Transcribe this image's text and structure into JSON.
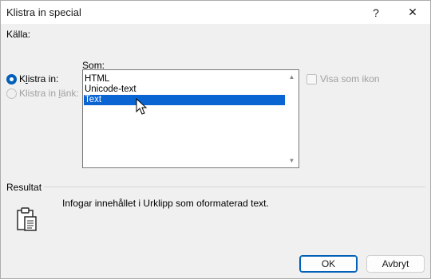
{
  "window": {
    "title": "Klistra in special",
    "help_label": "?",
    "close_label": "✕"
  },
  "source": {
    "label": "Källa:"
  },
  "paste_options": [
    {
      "prefix": "K",
      "underlined": "l",
      "rest": "istra in:",
      "checked": true,
      "enabled": true
    },
    {
      "prefix": "Klistra in ",
      "underlined": "l",
      "rest": "änk:",
      "checked": false,
      "enabled": false
    }
  ],
  "format_list": {
    "label_underlined": "S",
    "label_rest": "om:",
    "items": [
      "HTML",
      "Unicode-text",
      "Text"
    ],
    "selected_index": 2
  },
  "display_as_icon": {
    "label": "Visa som ikon",
    "checked": false,
    "enabled": false
  },
  "result": {
    "heading": "Resultat",
    "description": "Infogar innehållet i Urklipp som oformaterad text.",
    "icon": "clipboard-icon"
  },
  "buttons": {
    "ok": "OK",
    "cancel": "Avbryt"
  },
  "colors": {
    "accent": "#005fb8",
    "selection": "#0a64d2"
  }
}
